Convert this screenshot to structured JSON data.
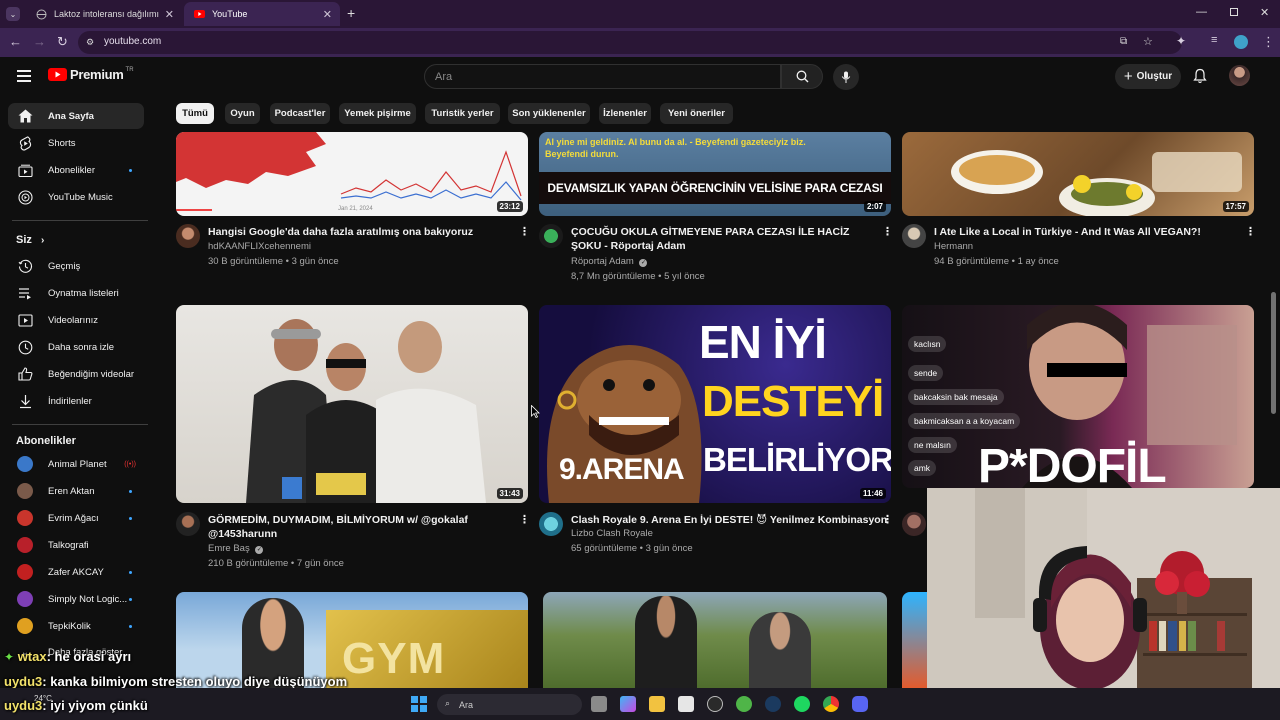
{
  "browser": {
    "tabs": [
      {
        "title": "Laktoz intoleransı dağılımı",
        "active": false
      },
      {
        "title": "YouTube",
        "active": true
      }
    ],
    "new_tab": "+",
    "url": "youtube.com"
  },
  "header": {
    "logo_text": "Premium",
    "logo_badge": "TR",
    "search_placeholder": "Ara",
    "create_label": "Oluştur"
  },
  "chips": [
    "Tümü",
    "Oyun",
    "Podcast'ler",
    "Yemek pişirme",
    "Turistik yerler",
    "Son yüklenenler",
    "İzlenenler",
    "Yeni öneriler"
  ],
  "sidebar": {
    "main": [
      {
        "label": "Ana Sayfa",
        "icon": "home-icon",
        "active": true
      },
      {
        "label": "Shorts",
        "icon": "shorts-icon"
      },
      {
        "label": "Abonelikler",
        "icon": "subscriptions-icon"
      },
      {
        "label": "YouTube Music",
        "icon": "music-icon"
      }
    ],
    "you_header": "Siz",
    "you": [
      {
        "label": "Geçmiş",
        "icon": "history-icon"
      },
      {
        "label": "Oynatma listeleri",
        "icon": "playlist-icon"
      },
      {
        "label": "Videolarınız",
        "icon": "your-videos-icon"
      },
      {
        "label": "Daha sonra izle",
        "icon": "watch-later-icon"
      },
      {
        "label": "Beğendiğim videolar",
        "icon": "liked-icon"
      },
      {
        "label": "İndirilenler",
        "icon": "download-icon"
      }
    ],
    "subs_header": "Abonelikler",
    "subs": [
      {
        "label": "Animal Planet",
        "color": "#3a78c9"
      },
      {
        "label": "Eren Aktan",
        "color": "#7a5a4a"
      },
      {
        "label": "Evrim Ağacı",
        "color": "#c9352c"
      },
      {
        "label": "Talkografi",
        "color": "#b8202a"
      },
      {
        "label": "Zafer AKCAY",
        "color": "#c22020"
      },
      {
        "label": "Simply Not Logic...",
        "color": "#7e3fb5"
      },
      {
        "label": "TepkiKolik",
        "color": "#e0a020"
      },
      {
        "label": "Daha fazla göster"
      }
    ]
  },
  "videos": [
    {
      "title": "Hangisi Google'da daha fazla aratılmış ona bakıyoruz",
      "channel": "hdKAANFLIXcehennemi",
      "meta": "30 B görüntüleme • 3 gün önce",
      "duration": "23:12"
    },
    {
      "title": "ÇOCUĞU OKULA GİTMEYENE PARA CEZASI İLE HACİZ ŞOKU - Röportaj Adam",
      "channel": "Röportaj Adam",
      "meta": "8,7 Mn görüntüleme • 5 yıl önce",
      "duration": "2:07",
      "thumb_text": "DEVAMSIZLIK YAPAN ÖĞRENCİNİN VELİSİNE PARA CEZASI",
      "thumb_caption": "Al yine mi geldiniz. Al bunu da al. - Beyefendi gazeteciyiz biz. Beyefendi durun."
    },
    {
      "title": "I Ate Like a Local in Türkiye - And It Was All VEGAN?!",
      "channel": "Hermann",
      "meta": "94 B görüntüleme • 1 ay önce",
      "duration": "17:57"
    },
    {
      "title": "GÖRMEDİM, DUYMADIM, BİLMİYORUM w/ @gokalaf @1453harunn",
      "channel": "Emre Baş",
      "meta": "210 B görüntüleme • 7 gün önce",
      "duration": "31:43"
    },
    {
      "title": "Clash Royale 9. Arena En İyi DESTE! 😈 Yenilmez Kombinasyon",
      "channel": "Lizbo Clash Royale",
      "meta": "65 görüntüleme • 3 gün önce",
      "duration": "11:46",
      "thumb_lines": [
        "EN İYİ",
        "DESTEYİ",
        "BELİRLİYORUZ"
      ],
      "thumb_arena": "9.ARENA"
    },
    {
      "thumb_text": "P*DOFİL",
      "chat_bubbles": [
        "kaclısn",
        "sende",
        "bakcaksin bak mesaja",
        "bakmicaksan a a koyacam",
        "ne malsın",
        "amk"
      ]
    },
    {
      "thumb_text": "GYM"
    },
    {}
  ],
  "chart_axis": "Jan 21, 2024",
  "chat": [
    {
      "user": "wtax",
      "text": ": he orasi ayrı"
    },
    {
      "user": "uydu3",
      "text": ": kanka bilmiyom stresten oluyo diye düşünüyom"
    },
    {
      "user": "uydu3",
      "text": ": iyi yiyom çünkü"
    }
  ],
  "taskbar": {
    "search_placeholder": "Ara",
    "weather": "24°C"
  }
}
